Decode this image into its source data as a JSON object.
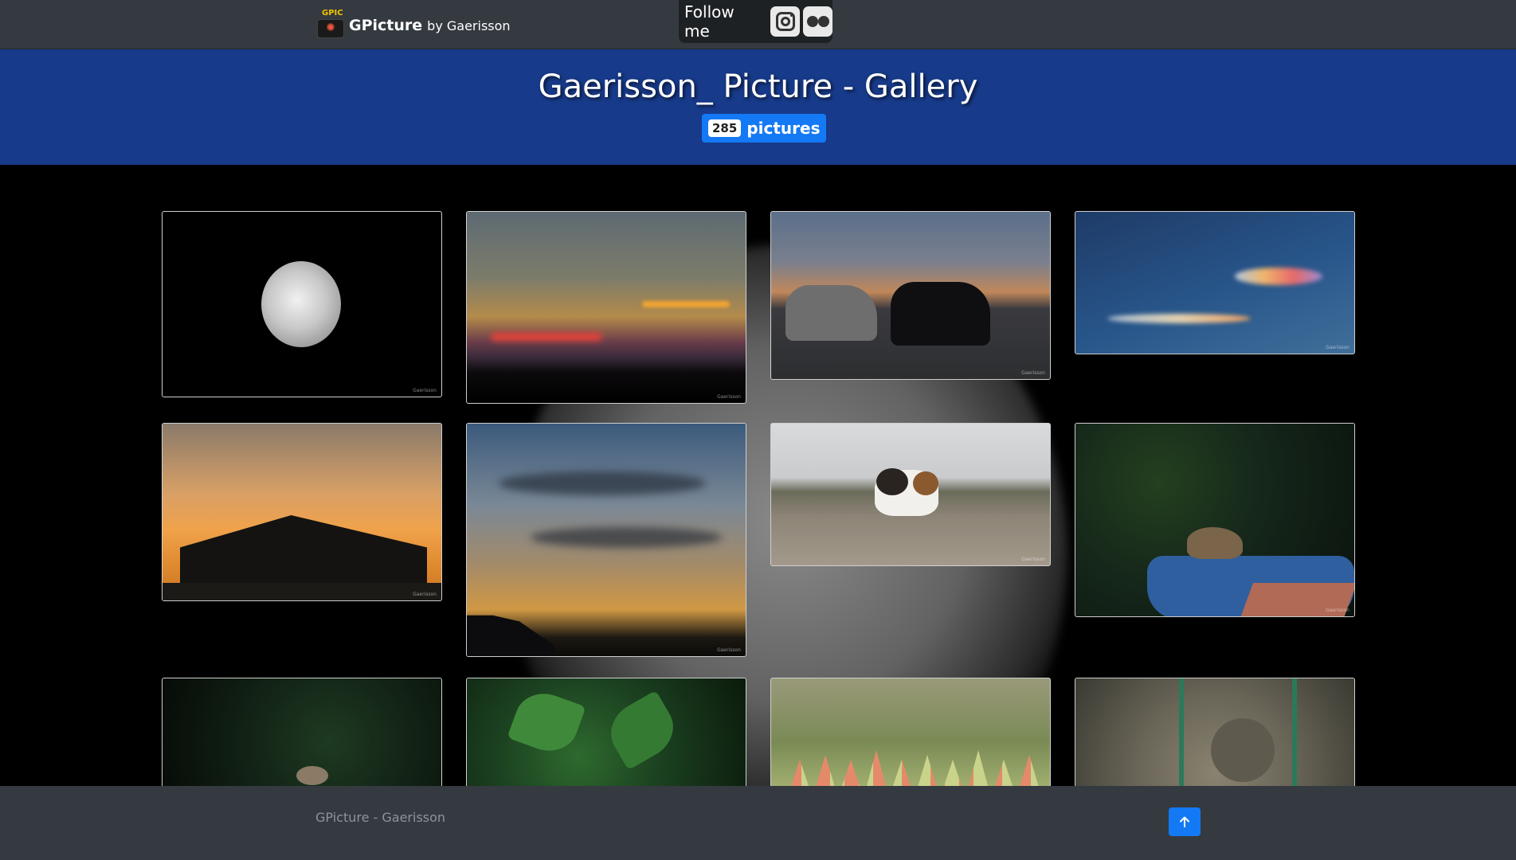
{
  "navbar": {
    "logo_text": "GPIC",
    "brand_name": "GPicture",
    "brand_by": "by Gaerisson",
    "follow_label": "Follow me",
    "social": [
      "instagram-icon",
      "flickr-icon"
    ]
  },
  "hero": {
    "title": "Gaerisson_ Picture - Gallery",
    "count": "285",
    "count_label": "pictures"
  },
  "gallery": {
    "photos": [
      {
        "subject": "moon"
      },
      {
        "subject": "sunset-clouds"
      },
      {
        "subject": "horses-silhouette"
      },
      {
        "subject": "iridescent-clouds"
      },
      {
        "subject": "barn-sunset"
      },
      {
        "subject": "cloudy-sky-sunset"
      },
      {
        "subject": "cat"
      },
      {
        "subject": "sparrow-on-bowl"
      },
      {
        "subject": "bird-in-leaves"
      },
      {
        "subject": "green-leaves"
      },
      {
        "subject": "succulents"
      },
      {
        "subject": "tortoise"
      }
    ],
    "watermark": "Gaerisson"
  },
  "footer": {
    "text": "GPicture - Gaerisson"
  },
  "colors": {
    "navbar": "#343a40",
    "hero": "#173a8a",
    "accent": "#1479f5"
  }
}
